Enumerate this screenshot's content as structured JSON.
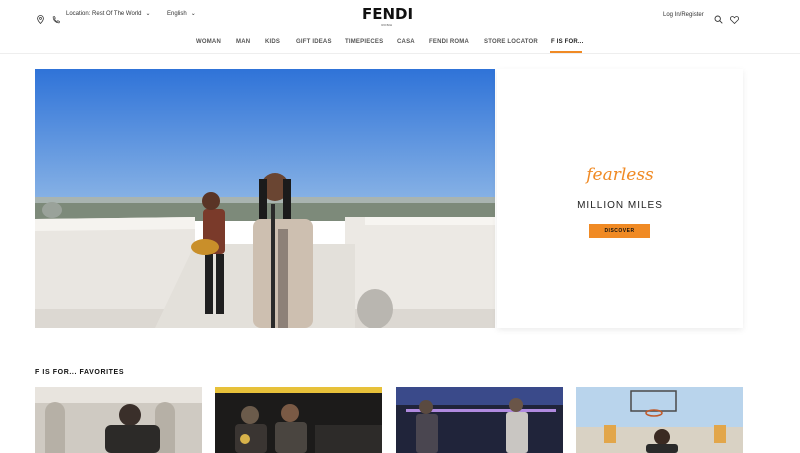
{
  "header": {
    "location_label": "Location: Rest Of The World",
    "language_label": "English",
    "brand_name": "FENDI",
    "brand_sub": "ROMA",
    "login_label": "Log In/Register",
    "icons": [
      "map-pin-icon",
      "phone-icon",
      "search-icon",
      "heart-icon"
    ]
  },
  "nav": {
    "items": [
      "WOMAN",
      "MAN",
      "KIDS",
      "GIFT IDEAS",
      "TIMEPIECES",
      "CASA",
      "FENDI ROMA",
      "STORE LOCATOR",
      "F IS FOR..."
    ],
    "active": "F IS FOR...",
    "accent_color": "#f08a24"
  },
  "hero": {
    "tagline": "fearless",
    "title": "MILLION MILES",
    "button_label": "DISCOVER"
  },
  "favorites": {
    "title": "F IS FOR... FAVORITES",
    "cards": [
      "favorite-1",
      "favorite-2",
      "favorite-3",
      "favorite-4"
    ]
  }
}
